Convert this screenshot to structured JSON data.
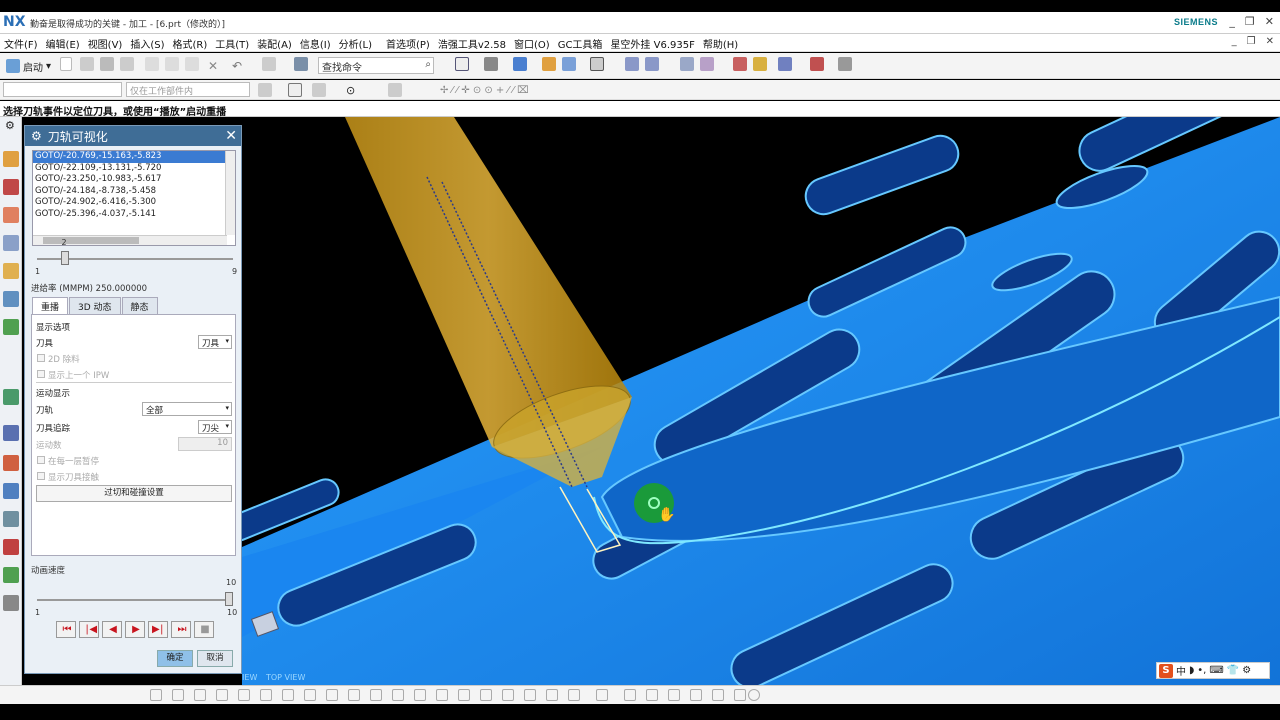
{
  "window": {
    "app_logo": "NX",
    "title": "勤奋是取得成功的关键 - 加工 - [6.prt（修改的）]",
    "brand": "SIEMENS",
    "controls": [
      "_",
      "❐",
      "✕"
    ]
  },
  "menubar": {
    "items": [
      "文件(F)",
      "编辑(E)",
      "视图(V)",
      "插入(S)",
      "格式(R)",
      "工具(T)",
      "装配(A)",
      "信息(I)",
      "分析(L)",
      "首选项(P)",
      "浩强工具v2.58",
      "窗口(O)",
      "GC工具箱",
      "星空外挂 V6.935F",
      "帮助(H)"
    ],
    "mdi_controls": [
      "_",
      "❐",
      "✕"
    ]
  },
  "toolbar": {
    "start_label": "启动",
    "search_placeholder": "查找命令",
    "search_icon": "search-icon"
  },
  "toolbar2": {
    "filter_value": "",
    "scope_value": "仅在工作部件内"
  },
  "cue": {
    "message": "选择刀轨事件以定位刀具，或使用“播放”启动重播"
  },
  "dialog": {
    "title": "刀轨可视化",
    "gear_icon": "gear-icon",
    "goto_list": [
      "GOTO/-20.769,-15.163,-5.823",
      "GOTO/-22.109,-13.131,-5.720",
      "GOTO/-23.250,-10.983,-5.617",
      "GOTO/-24.184,-8.738,-5.458",
      "GOTO/-24.902,-6.416,-5.300",
      "GOTO/-25.396,-4.037,-5.141"
    ],
    "selected_index": 0,
    "position_slider": {
      "value": "2",
      "min": "1",
      "max": "9",
      "fraction": 0.125
    },
    "feedrate": "进给率 (MMPM) 250.000000",
    "tabs": [
      "重播",
      "3D 动态",
      "静态"
    ],
    "active_tab": 0,
    "display_options": {
      "heading": "显示选项",
      "tool_label": "刀具",
      "tool_value": "刀具",
      "cb_2d_material": "2D 除料",
      "cb_prev_ipw": "显示上一个 IPW"
    },
    "motion_display": {
      "heading": "运动显示",
      "path_label": "刀轨",
      "path_value": "全部",
      "trace_label": "刀具追踪",
      "trace_value": "刀尖",
      "motion_count_label": "运动数",
      "motion_count_value": "10",
      "cb_pause_each_layer": "在每一层暂停",
      "cb_show_tool_contact": "显示刀具接触"
    },
    "gouge_button": "过切和碰撞设置",
    "anim_speed": {
      "label": "动画速度",
      "value": "10",
      "min": "1",
      "max": "10",
      "fraction": 1.0
    },
    "playback": [
      "⏮",
      "❘◀",
      "◀",
      "▶",
      "▶❘",
      "⏭",
      "■"
    ],
    "ok_label": "确定",
    "cancel_label": "取消"
  },
  "viewport": {
    "view_labels": [
      "TOP VIEW",
      "TOP VIEW"
    ]
  },
  "ime": {
    "logo": "S",
    "lang": "中",
    "extras": [
      "◗",
      "•,",
      "⌨",
      "👕",
      "⚙"
    ]
  },
  "colors": {
    "part_blue": "#1e90ff",
    "tool_yellow": "#d4a017",
    "dialog_title": "#3f6d96",
    "play_red": "#c8141e"
  }
}
